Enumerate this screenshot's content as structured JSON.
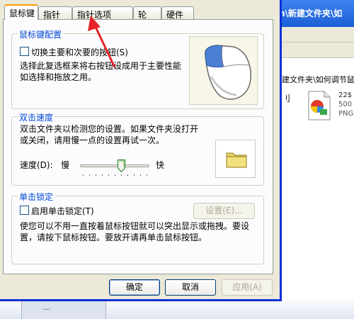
{
  "background": {
    "titlebar": "n\\新建文件夹\\如",
    "path_text": "建文件夹\\如何调节鼠",
    "partial_text": "刂",
    "file": {
      "name": "22$",
      "size": "500",
      "type": "PNG"
    },
    "bottom_item": "..."
  },
  "tabs": [
    {
      "label": "鼠标键"
    },
    {
      "label": "指针"
    },
    {
      "label": "指针选项"
    },
    {
      "label": "轮"
    },
    {
      "label": "硬件"
    }
  ],
  "button_config": {
    "title": "鼠标键配置",
    "checkbox_label": "切换主要和次要的按钮(S)",
    "description": "选择此复选框来将右按钮设成用于主要性能如选择和拖放之用。"
  },
  "double_click": {
    "title": "双击速度",
    "description": "双击文件夹以检测您的设置。如果文件夹没打开或关闭，请用慢一点的设置再试一次。",
    "speed_label": "速度(D):",
    "slow": "慢",
    "fast": "快",
    "speed_level": 0.6
  },
  "click_lock": {
    "title": "单击锁定",
    "checkbox_label": "启用单击锁定(T)",
    "settings_button": "设置(E)...",
    "description": "使您可以不用一直按着鼠标按钮就可以突出显示或拖拽。要设置，请按下鼠标按钮。要放开请再单击鼠标按钮。"
  },
  "footer": {
    "ok": "确定",
    "cancel": "取消",
    "apply": "应用(A)"
  },
  "colors": {
    "accent": "#0046d5",
    "tab_highlight": "#ff9900",
    "annotation": "#e8232a"
  }
}
